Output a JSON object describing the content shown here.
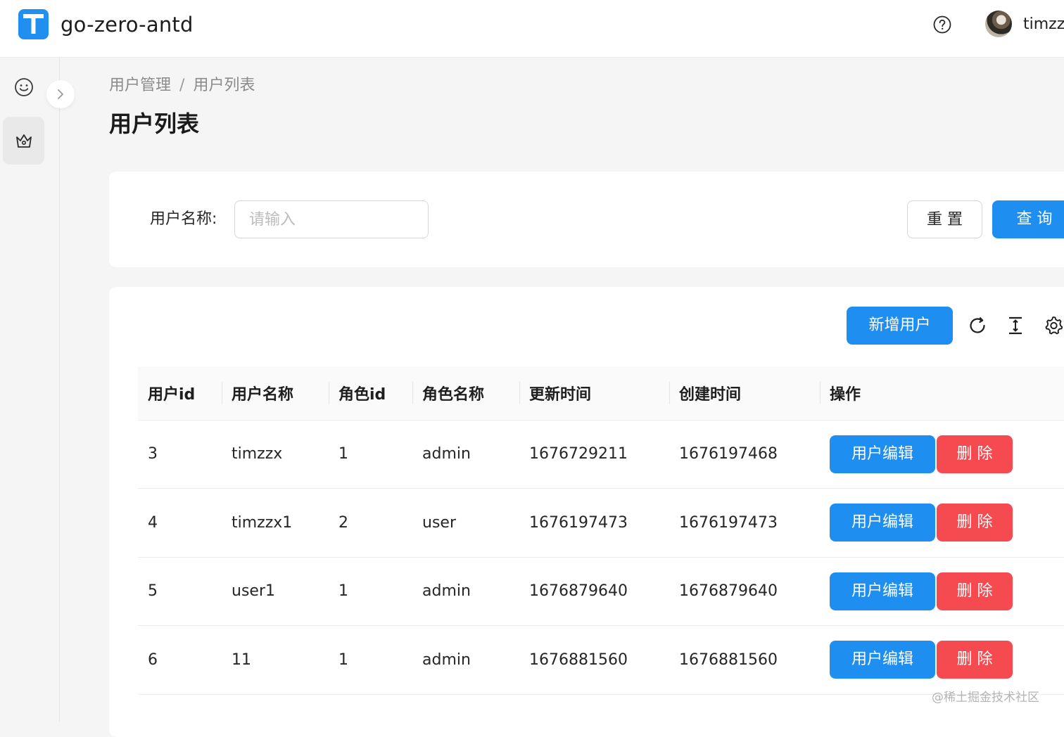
{
  "header": {
    "app_title": "go-zero-antd",
    "logo_letter": "T",
    "username": "timzzx",
    "accent": "#1e8ff0"
  },
  "sider": {
    "items": [
      {
        "icon": "smile-icon",
        "active": false
      },
      {
        "icon": "crown-icon",
        "active": true
      }
    ]
  },
  "breadcrumb": {
    "items": [
      "用户管理",
      "用户列表"
    ],
    "separator": "/"
  },
  "page": {
    "title": "用户列表"
  },
  "search": {
    "label": "用户名称:",
    "placeholder": "请输入",
    "value": "",
    "reset_label": "重 置",
    "query_label": "查 询"
  },
  "toolbar": {
    "add_label": "新增用户",
    "icons": [
      "reload-icon",
      "column-height-icon",
      "setting-icon"
    ]
  },
  "table": {
    "columns": [
      "用户id",
      "用户名称",
      "角色id",
      "角色名称",
      "更新时间",
      "创建时间",
      "操作"
    ],
    "rows": [
      {
        "id": "3",
        "name": "timzzx",
        "role_id": "1",
        "role_name": "admin",
        "updated": "1676729211",
        "created": "1676197468"
      },
      {
        "id": "4",
        "name": "timzzx1",
        "role_id": "2",
        "role_name": "user",
        "updated": "1676197473",
        "created": "1676197473"
      },
      {
        "id": "5",
        "name": "user1",
        "role_id": "1",
        "role_name": "admin",
        "updated": "1676879640",
        "created": "1676879640"
      },
      {
        "id": "6",
        "name": "11",
        "role_id": "1",
        "role_name": "admin",
        "updated": "1676881560",
        "created": "1676881560"
      }
    ],
    "edit_label": "用户编辑",
    "delete_label": "删 除",
    "edit_color": "#1e8ff0",
    "delete_color": "#f54a4f"
  },
  "watermark": "@稀土掘金技术社区"
}
